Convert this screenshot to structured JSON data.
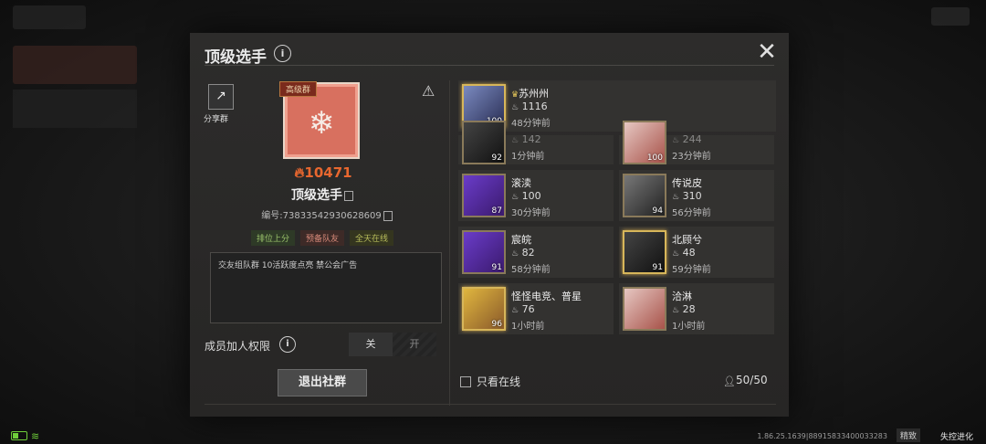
{
  "dialog": {
    "title": "顶级选手",
    "info_icon": "i",
    "close_icon": "✕"
  },
  "group": {
    "share_label": "分享群",
    "tier_badge": "高级群",
    "heat": "10471",
    "name": "顶级选手",
    "id_text": "编号:73833542930628609",
    "tags": [
      "排位上分",
      "预备队友",
      "全天在线"
    ],
    "description": "交友组队群 10活跃度点亮 禁公会广告",
    "permission_label": "成员加人权限",
    "toggle_off": "关",
    "toggle_on": "开",
    "exit_button": "退出社群"
  },
  "members": [
    {
      "name": "苏州州",
      "heat": "1116",
      "time": "48分钟前",
      "level": "100",
      "owner": true
    },
    {
      "name": "",
      "heat": "142",
      "time": "1分钟前",
      "level": "92",
      "owner": false
    },
    {
      "name": "",
      "heat": "244",
      "time": "23分钟前",
      "level": "100",
      "owner": false
    },
    {
      "name": "滚渎",
      "heat": "100",
      "time": "30分钟前",
      "level": "87",
      "owner": false
    },
    {
      "name": "传说皮",
      "heat": "310",
      "time": "56分钟前",
      "level": "94",
      "owner": false
    },
    {
      "name": "宸皖",
      "heat": "82",
      "time": "58分钟前",
      "level": "91",
      "owner": false
    },
    {
      "name": "北顾兮",
      "heat": "48",
      "time": "59分钟前",
      "level": "91",
      "owner": false
    },
    {
      "name": "怪怪电竞、普星",
      "heat": "76",
      "time": "1小时前",
      "level": "96",
      "owner": false
    },
    {
      "name": "洽淋",
      "heat": "28",
      "time": "1小时前",
      "level": "",
      "owner": false
    }
  ],
  "footer": {
    "online_only": "只看在线",
    "member_count": "50/50"
  },
  "statusbar": {
    "version": "1.86.25.1639|88915833400033283",
    "quality": "精致",
    "brand": "失控进化"
  }
}
